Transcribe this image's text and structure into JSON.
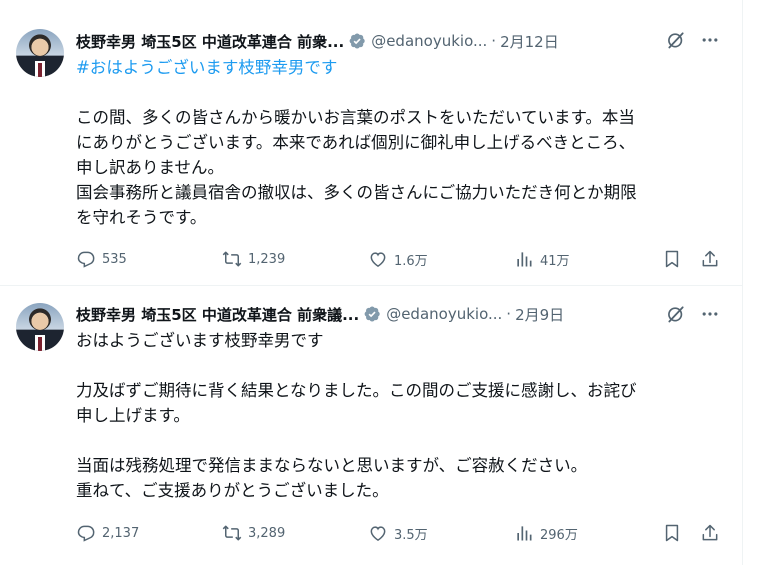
{
  "tweets": [
    {
      "author_name": "枝野幸男 埼玉5区 中道改革連合 前衆...",
      "handle": "@edanoyukio...",
      "separator": "·",
      "date": "2月12日",
      "lines": [
        {
          "text": "#おはようございます枝野幸男です",
          "style": "hashtag"
        },
        {
          "text": "",
          "style": "plain"
        },
        {
          "text": "この間、多くの皆さんから暖かいお言葉のポストをいただいています。本当",
          "style": "plain"
        },
        {
          "text": "にありがとうございます。本来であれば個別に御礼申し上げるべきところ、",
          "style": "plain"
        },
        {
          "text": "申し訳ありません。",
          "style": "plain"
        },
        {
          "text": "国会事務所と議員宿舎の撤収は、多くの皆さんにご協力いただき何とか期限",
          "style": "plain"
        },
        {
          "text": "を守れそうです。",
          "style": "plain"
        }
      ],
      "replies": "535",
      "retweets": "1,239",
      "likes": "1.6万",
      "views": "41万"
    },
    {
      "author_name": "枝野幸男 埼玉5区 中道改革連合 前衆議...",
      "handle": "@edanoyukio...",
      "separator": "·",
      "date": "2月9日",
      "lines": [
        {
          "text": "おはようございます枝野幸男です",
          "style": "plain"
        },
        {
          "text": "",
          "style": "plain"
        },
        {
          "text": "力及ばずご期待に背く結果となりました。この間のご支援に感謝し、お詫び",
          "style": "plain"
        },
        {
          "text": "申し上げます。",
          "style": "plain"
        },
        {
          "text": "",
          "style": "plain"
        },
        {
          "text": "当面は残務処理で発信ままならないと思いますが、ご容赦ください。",
          "style": "plain"
        },
        {
          "text": "重ねて、ご支援ありがとうございました。",
          "style": "plain"
        }
      ],
      "replies": "2,137",
      "retweets": "3,289",
      "likes": "3.5万",
      "views": "296万"
    }
  ],
  "icons": {
    "verified": "verified-badge-icon",
    "grok": "grok-icon",
    "more": "more-icon",
    "reply": "reply-icon",
    "retweet": "retweet-icon",
    "like": "heart-icon",
    "views": "views-icon",
    "bookmark": "bookmark-icon",
    "share": "share-icon"
  },
  "colors": {
    "text": "#0f1419",
    "secondary": "#536471",
    "link": "#1d9bf0",
    "verified": "#829aab",
    "divider": "#eff3f4"
  }
}
